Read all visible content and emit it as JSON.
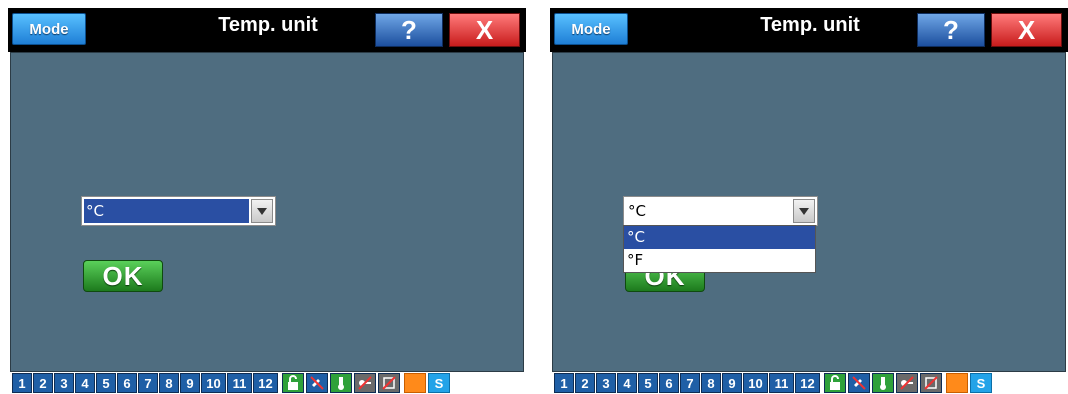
{
  "screens": [
    {
      "mode_label": "Mode",
      "title": "Temp. unit",
      "help_label": "?",
      "close_label": "X",
      "select_value": "°C",
      "ok_label": "OK",
      "dropdown_open": false
    },
    {
      "mode_label": "Mode",
      "title": "Temp. unit",
      "help_label": "?",
      "close_label": "X",
      "select_value": "°C",
      "ok_label": "OK",
      "dropdown_open": true,
      "dropdown_options": [
        "°C",
        "°F"
      ],
      "dropdown_selected_index": 0
    }
  ],
  "bottom_bar": {
    "numbers": [
      "1",
      "2",
      "3",
      "4",
      "5",
      "6",
      "7",
      "8",
      "9",
      "10",
      "11",
      "12"
    ],
    "icons": [
      "lock-open-icon",
      "no-sync-icon",
      "thermometer-icon",
      "key-off-icon",
      "no-edit-icon",
      "orange-square-icon",
      "s-badge-icon"
    ],
    "s_label": "S"
  },
  "colors": {
    "content_bg": "#4f6d80",
    "titlebar_bg": "#000000",
    "select_highlight": "#2a4fa3"
  }
}
